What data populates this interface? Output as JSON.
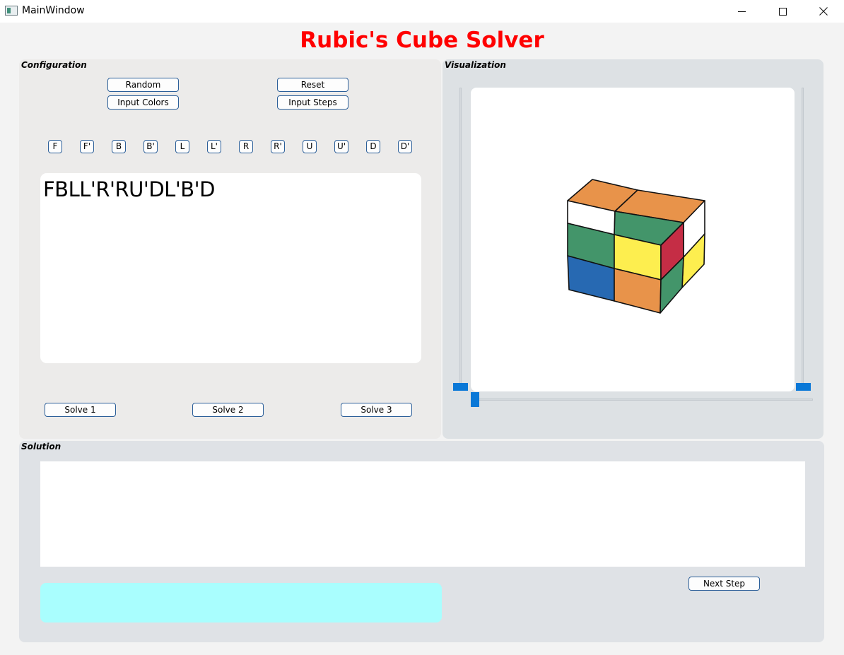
{
  "window": {
    "title": "MainWindow",
    "minimize_label": "—",
    "maximize_label": "☐",
    "close_label": "✕"
  },
  "app": {
    "title": "Rubic's Cube Solver",
    "title_color": "#ff0000"
  },
  "configuration": {
    "label": "Configuration",
    "random_label": "Random",
    "reset_label": "Reset",
    "input_colors_label": "Input Colors",
    "input_steps_label": "Input Steps",
    "moves": [
      "F",
      "F'",
      "B",
      "B'",
      "L",
      "L'",
      "R",
      "R'",
      "U",
      "U'",
      "D",
      "D'"
    ],
    "steps_text": "FBLL'R'RU'DL'B'D",
    "solve1_label": "Solve 1",
    "solve2_label": "Solve 2",
    "solve3_label": "Solve 3"
  },
  "visualization": {
    "label": "Visualization",
    "cube_colors": {
      "orange": "#e8934a",
      "white": "#ffffff",
      "green": "#43956a",
      "yellow": "#fdee4f",
      "red": "#c52d45",
      "blue": "#2769b2"
    }
  },
  "solution": {
    "label": "Solution",
    "solution_text": "",
    "status_text": "",
    "next_step_label": "Next Step",
    "status_color": "#a9fefe"
  }
}
